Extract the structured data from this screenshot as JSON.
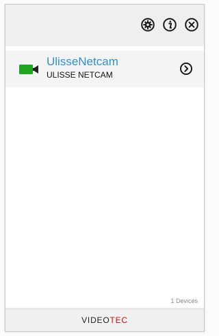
{
  "header": {
    "settings_icon": "gear-icon",
    "info_icon": "info-icon",
    "close_icon": "close-icon"
  },
  "devices": [
    {
      "name": "UlisseNetcam",
      "model": "ULISSE NETCAM",
      "icon": "camera-icon",
      "action_icon": "chevron-right-circle-icon"
    }
  ],
  "status": {
    "device_count": "1 Devices"
  },
  "footer": {
    "brand_left": "VIDEO",
    "brand_right": "TEC"
  },
  "colors": {
    "accent": "#2f8fda",
    "camera_green": "#1fa51f",
    "brand_red": "#d20f0f"
  }
}
